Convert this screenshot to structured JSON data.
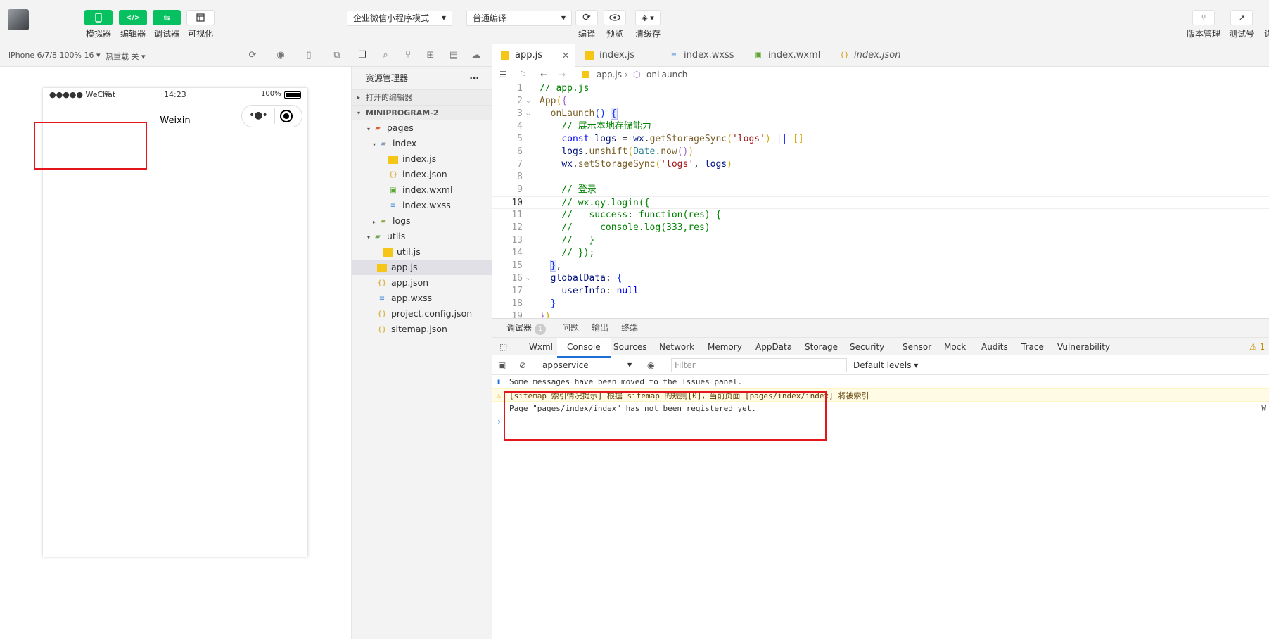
{
  "toolbar": {
    "simulator": "模拟器",
    "editor": "编辑器",
    "debugger": "调试器",
    "visual": "可视化",
    "mode_select": "企业微信小程序模式",
    "compile_select": "普通编译",
    "compile": "编译",
    "preview": "预览",
    "clear_cache": "清缓存",
    "version": "版本管理",
    "test": "测试号",
    "detail": "详"
  },
  "subbar": {
    "device": "iPhone 6/7/8 100% 16 ▾",
    "hot_reload": "热重载 关 ▾"
  },
  "phone": {
    "carrier": "●●●●● WeChat",
    "time": "14:23",
    "battery": "100%",
    "title": "Weixin"
  },
  "explorer": {
    "title": "资源管理器",
    "more": "···",
    "open_editors": "打开的编辑器",
    "project": "MINIPROGRAM-2",
    "items": [
      {
        "label": "pages"
      },
      {
        "label": "index"
      },
      {
        "label": "index.js"
      },
      {
        "label": "index.json"
      },
      {
        "label": "index.wxml"
      },
      {
        "label": "index.wxss"
      },
      {
        "label": "logs"
      },
      {
        "label": "utils"
      },
      {
        "label": "util.js"
      },
      {
        "label": "app.js"
      },
      {
        "label": "app.json"
      },
      {
        "label": "app.wxss"
      },
      {
        "label": "project.config.json"
      },
      {
        "label": "sitemap.json"
      }
    ]
  },
  "editor": {
    "tabs": [
      {
        "label": "app.js"
      },
      {
        "label": "index.js"
      },
      {
        "label": "index.wxss"
      },
      {
        "label": "index.wxml"
      },
      {
        "label": "index.json"
      }
    ],
    "breadcrumb_file": "app.js",
    "breadcrumb_symbol": "onLaunch",
    "line_numbers": [
      "1",
      "2",
      "3",
      "4",
      "5",
      "6",
      "7",
      "8",
      "9",
      "10",
      "11",
      "12",
      "13",
      "14",
      "15",
      "16",
      "17",
      "18",
      "19"
    ]
  },
  "debug": {
    "tab_debugger": "调试器",
    "badge": "1",
    "tab_issues": "问题",
    "tab_output": "输出",
    "tab_terminal": "终端",
    "panels": [
      {
        "label": "Wxml"
      },
      {
        "label": "Console"
      },
      {
        "label": "Sources"
      },
      {
        "label": "Network"
      },
      {
        "label": "Memory"
      },
      {
        "label": "AppData"
      },
      {
        "label": "Storage"
      },
      {
        "label": "Security"
      },
      {
        "label": "Sensor"
      },
      {
        "label": "Mock"
      },
      {
        "label": "Audits"
      },
      {
        "label": "Trace"
      },
      {
        "label": "Vulnerability"
      }
    ],
    "warn_count": "⚠ 1",
    "context": "appservice",
    "filter_placeholder": "Filter",
    "levels": "Default levels ▾",
    "messages": [
      "Some messages have been moved to the Issues panel.",
      "[sitemap 索引情况提示] 根据 sitemap 的规则[0]，当前页面 [pages/index/index] 将被索引",
      "Page \"pages/index/index\" has not been registered yet."
    ],
    "side_link": "W"
  }
}
